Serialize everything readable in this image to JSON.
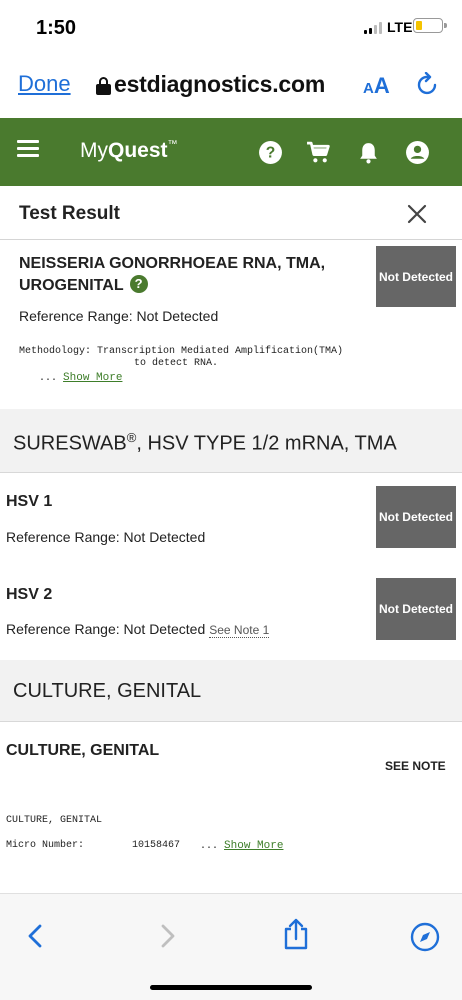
{
  "status": {
    "time": "1:50",
    "network": "LTE"
  },
  "browser": {
    "done_label": "Done",
    "url": "estdiagnostics.com",
    "text_size_label": "AA"
  },
  "app": {
    "brand_prefix": "My",
    "brand_name": "Quest",
    "brand_mark": "™",
    "header_color": "#4a7a2e"
  },
  "panel": {
    "title": "Test Result"
  },
  "results": {
    "gonorrhea": {
      "name_line1": "NEISSERIA GONORRHOEAE RNA, TMA,",
      "name_line2": "UROGENITAL",
      "help": "?",
      "result": "Not Detected",
      "reference": "Reference Range: Not Detected",
      "methodology_line1": "Methodology: Transcription Mediated Amplification(TMA)",
      "methodology_line2": "to detect RNA.",
      "ellipsis": "...",
      "show_more": "Show More"
    },
    "sureswab_header": "SURESWAB",
    "sureswab_mark": "®",
    "sureswab_rest": ", HSV TYPE 1/2 mRNA, TMA",
    "hsv1": {
      "name": "HSV 1",
      "result": "Not Detected",
      "reference": "Reference Range: Not Detected"
    },
    "hsv2": {
      "name": "HSV 2",
      "result": "Not Detected",
      "reference": "Reference Range: Not Detected",
      "note_link": "See Note 1"
    },
    "culture_header": "CULTURE, GENITAL",
    "culture": {
      "name": "CULTURE, GENITAL",
      "result": "SEE NOTE",
      "detail_line1": "CULTURE, GENITAL",
      "micro_label": "Micro Number:",
      "micro_value": "10158467",
      "ellipsis": "...",
      "show_more": "Show More"
    }
  },
  "icons": [
    "lock-icon",
    "reload-icon",
    "menu-icon",
    "help-icon",
    "cart-icon",
    "bell-icon",
    "account-icon",
    "close-icon",
    "back-icon",
    "forward-icon",
    "share-icon",
    "compass-icon"
  ]
}
